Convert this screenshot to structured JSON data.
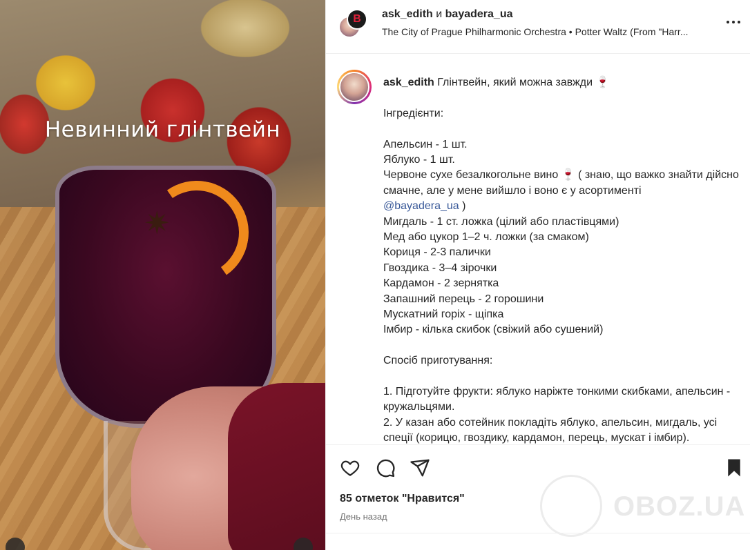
{
  "media": {
    "overlay_text": "Невинний глінтвейн"
  },
  "header": {
    "user1": "ask_edith",
    "conj": "и",
    "user2": "bayadera_ua",
    "audio": "The City of Prague Philharmonic Orchestra • Potter Waltz (From \"Harr...",
    "more_icon": "more-horizontal-icon"
  },
  "caption": {
    "username": "ask_edith",
    "first_text": " Глінтвейн, який можна завжди 🍷",
    "lines": [
      "",
      "Інгредієнти:",
      "",
      "Апельсин - 1 шт.",
      "Яблуко - 1 шт.",
      "Червоне сухе безалкогольне вино 🍷 ( знаю, що важко знайти дійсно смачне, але у мене вийшло і воно є у асортименті"
    ],
    "mention": "@bayadera_ua",
    "after_mention": " )",
    "lines2": [
      "Мигдаль - 1 ст. ложка (цілий або пластівцями)",
      "Мед або цукор 1–2 ч. ложки (за смаком)",
      "Кориця - 2-3 палички",
      "Гвоздика - 3–4 зірочки",
      "Кардамон - 2 зернятка",
      "Запашний перець - 2 горошини",
      "Мускатний горіх - щіпка",
      "Імбир - кілька скибок (свіжий або сушений)",
      "",
      "Спосіб приготування:",
      "",
      "1. Підготуйте фрукти: яблуко наріжте тонкими скибками, апельсин - кружальцями.",
      "2. У казан або сотейник покладіть яблуко, апельсин, мигдаль, усі спеції (корицю, гвоздику, кардамон, перець, мускат і імбир)."
    ]
  },
  "actions": {
    "like_icon": "heart-icon",
    "comment_icon": "comment-icon",
    "share_icon": "share-icon",
    "save_icon": "bookmark-icon"
  },
  "likes_text": "85 отметок \"Нравится\"",
  "time_text": "День назад",
  "watermark": "OBOZ.UA"
}
